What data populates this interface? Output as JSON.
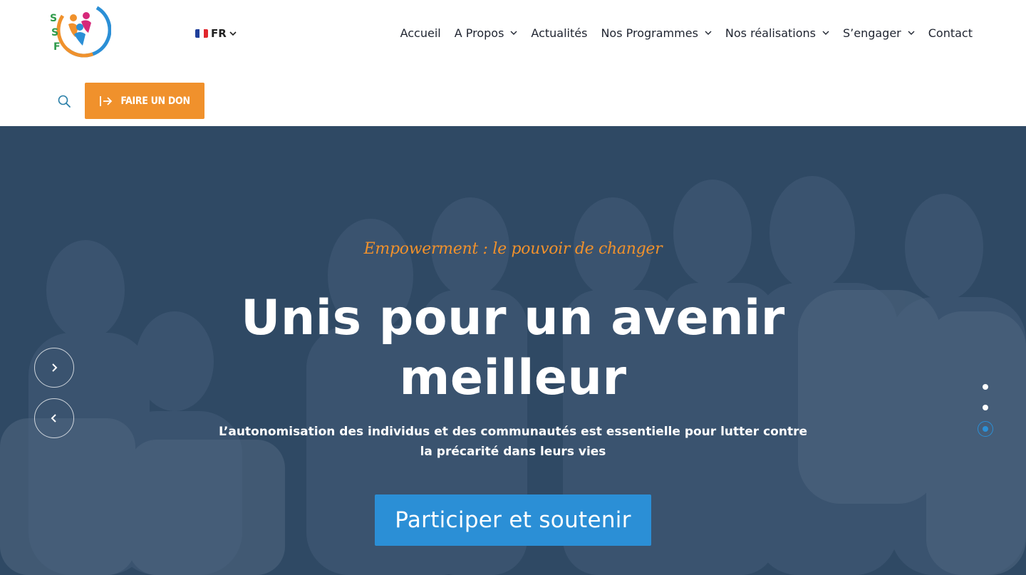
{
  "header": {
    "logo_icon": "ssf-logo",
    "language": {
      "code": "FR",
      "flag_icon": "france-flag-icon",
      "flag_colors": [
        "#1f3f9a",
        "#ffffff",
        "#e1262d"
      ]
    },
    "nav": [
      {
        "label": "Accueil",
        "has_dropdown": false
      },
      {
        "label": "A Propos",
        "has_dropdown": true
      },
      {
        "label": "Actualités",
        "has_dropdown": false
      },
      {
        "label": "Nos Programmes",
        "has_dropdown": true
      },
      {
        "label": "Nos réalisations",
        "has_dropdown": true
      },
      {
        "label": "S’engager",
        "has_dropdown": true
      },
      {
        "label": "Contact",
        "has_dropdown": false
      }
    ],
    "search_icon": "search-icon",
    "donate": {
      "label": "FAIRE UN DON",
      "icon": "arrow-right-bar-icon"
    }
  },
  "hero": {
    "tagline": "Empowerment : le pouvoir de changer",
    "title": "Unis pour un avenir meilleur",
    "subtitle": "L’autonomisation des individus et des communautés est essentielle pour lutter contre la précarité dans leurs vies",
    "cta_label": "Participer et soutenir",
    "slider": {
      "slides": 3,
      "active": 3
    }
  },
  "colors": {
    "accent_orange": "#f0912c",
    "accent_blue": "#2b8fd6",
    "nav_text": "#1f2430",
    "search_icon": "#2a7fa8"
  }
}
